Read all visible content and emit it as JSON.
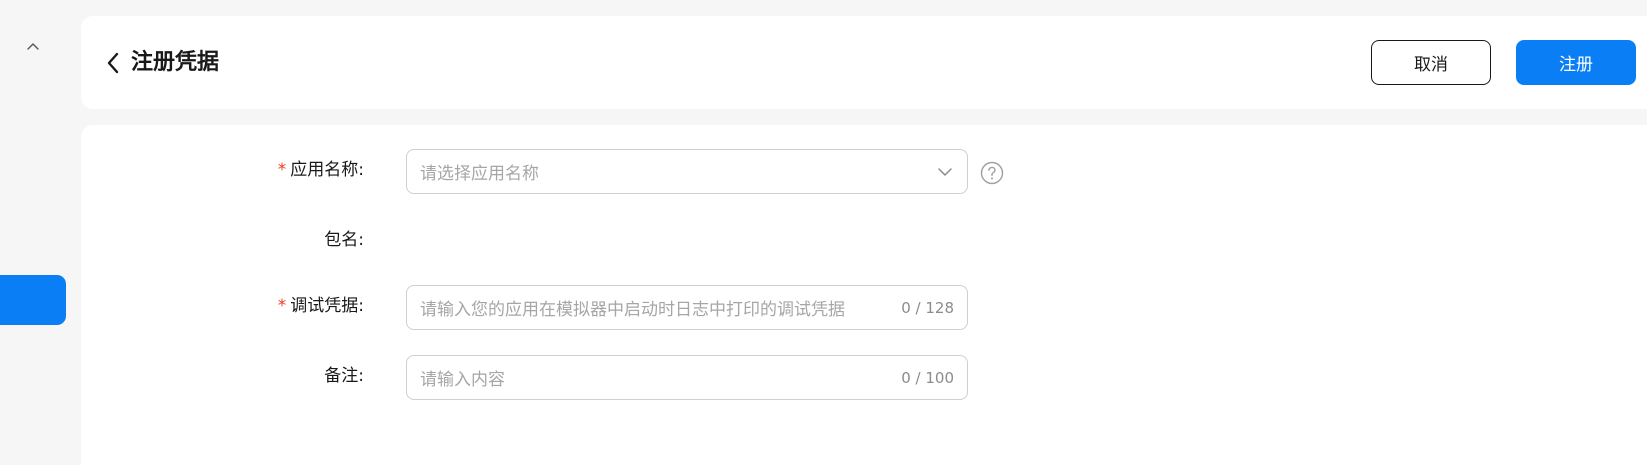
{
  "header": {
    "title": "注册凭据",
    "cancel_label": "取消",
    "submit_label": "注册"
  },
  "form": {
    "app_name": {
      "label": "应用名称:",
      "required": true,
      "placeholder": "请选择应用名称"
    },
    "package_name": {
      "label": "包名:",
      "required": false,
      "value": ""
    },
    "debug_credential": {
      "label": "调试凭据:",
      "required": true,
      "placeholder": "请输入您的应用在模拟器中启动时日志中打印的调试凭据",
      "counter": "0 / 128"
    },
    "remark": {
      "label": "备注:",
      "required": false,
      "placeholder": "请输入内容",
      "counter": "0 / 100"
    },
    "required_mark": "*"
  },
  "icons": {
    "collapse": "chevron-up-icon",
    "back": "chevron-left-icon",
    "select": "chevron-down-icon",
    "help": "question-circle-icon"
  },
  "colors": {
    "accent": "#0a7ff5",
    "required": "#e84026",
    "background": "#f6f6f6",
    "card": "#ffffff"
  }
}
